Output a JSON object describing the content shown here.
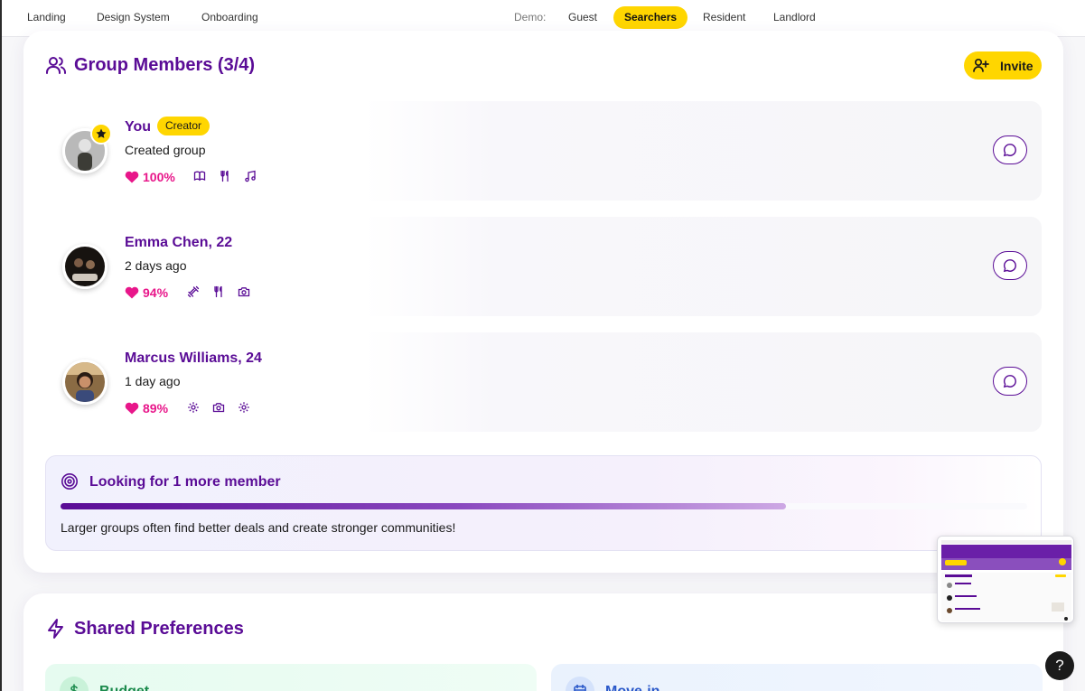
{
  "nav": {
    "links": [
      "Landing",
      "Design System",
      "Onboarding"
    ],
    "demo_label": "Demo:",
    "demo_options": [
      "Guest",
      "Searchers",
      "Resident",
      "Landlord"
    ],
    "demo_selected": "Searchers"
  },
  "members_card": {
    "title": "Group Members (3/4)",
    "invite_label": "Invite",
    "members": [
      {
        "name": "You",
        "badge": "Creator",
        "subtitle": "Created group",
        "match": "100%",
        "interests": [
          "book-icon",
          "utensils-icon",
          "music-icon"
        ]
      },
      {
        "name": "Emma Chen, 22",
        "subtitle": "2 days ago",
        "match": "94%",
        "interests": [
          "dumbbell-icon",
          "utensils-icon",
          "camera-icon"
        ]
      },
      {
        "name": "Marcus Williams, 24",
        "subtitle": "1 day ago",
        "match": "89%",
        "interests": [
          "gear-icon",
          "camera-icon",
          "gear-icon"
        ]
      }
    ],
    "looking": {
      "title": "Looking for 1 more member",
      "progress": 0.75,
      "tip": "Larger groups often find better deals and create stronger communities!"
    }
  },
  "preferences_card": {
    "title": "Shared Preferences",
    "tiles": [
      "Budget",
      "Move-in"
    ]
  },
  "help_label": "?",
  "colors": {
    "brand_purple": "#5a0c96",
    "accent_yellow": "#ffd600",
    "match_pink": "#e8168a"
  }
}
